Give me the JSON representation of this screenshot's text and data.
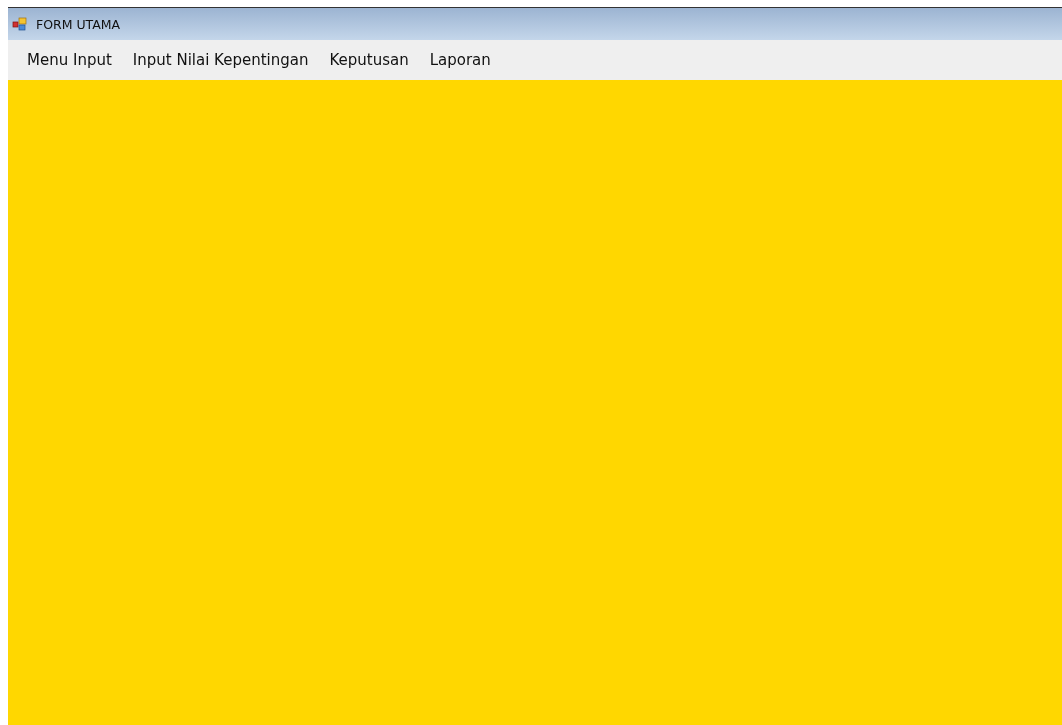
{
  "window": {
    "title": "FORM UTAMA"
  },
  "menu": [
    {
      "label": "Menu Input"
    },
    {
      "label": "Input Nilai Kepentingan"
    },
    {
      "label": "Keputusan"
    },
    {
      "label": "Laporan"
    }
  ]
}
